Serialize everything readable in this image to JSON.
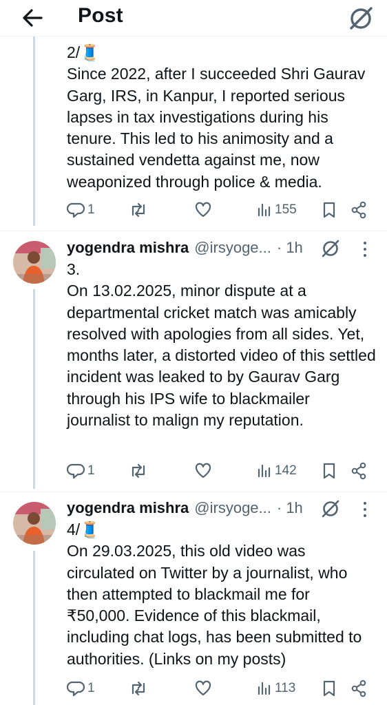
{
  "header": {
    "title": "Post"
  },
  "tweets": [
    {
      "text": "2/🧵\nSince 2022, after I succeeded Shri Gaurav Garg, IRS, in Kanpur, I reported serious lapses in tax investigations during his tenure. This led to his animosity and a sustained vendetta against me, now weaponized through police & media.",
      "replies": "1",
      "views": "155"
    },
    {
      "name": "yogendra mishra",
      "handle": "@irsyoge...",
      "time": "· 1h",
      "text": "3.\nOn 13.02.2025, minor dispute at a departmental cricket match was amicably resolved with apologies from all sides. Yet, months later, a distorted video of this settled incident was leaked to by Gaurav Garg through his IPS wife to blackmailer journalist to malign my reputation.",
      "replies": "1",
      "views": "142"
    },
    {
      "name": "yogendra mishra",
      "handle": "@irsyoge...",
      "time": "· 1h",
      "text": "4/🧵\nOn 29.03.2025, this old video was circulated on Twitter by a journalist, who then attempted to blackmail me for ₹50,000. Evidence of this blackmail, including chat logs, has been submitted to authorities. (Links on my posts)",
      "replies": "1",
      "views": "113"
    }
  ],
  "icons": {
    "back": "arrow-left-icon",
    "grok": "grok-icon",
    "reply": "reply-icon",
    "repost": "repost-icon",
    "like": "heart-icon",
    "views": "views-icon",
    "bookmark": "bookmark-icon",
    "share": "share-icon",
    "more": "more-vertical-icon"
  },
  "colors": {
    "text": "#0f1419",
    "secondary": "#536471",
    "line": "#cfd9de"
  }
}
